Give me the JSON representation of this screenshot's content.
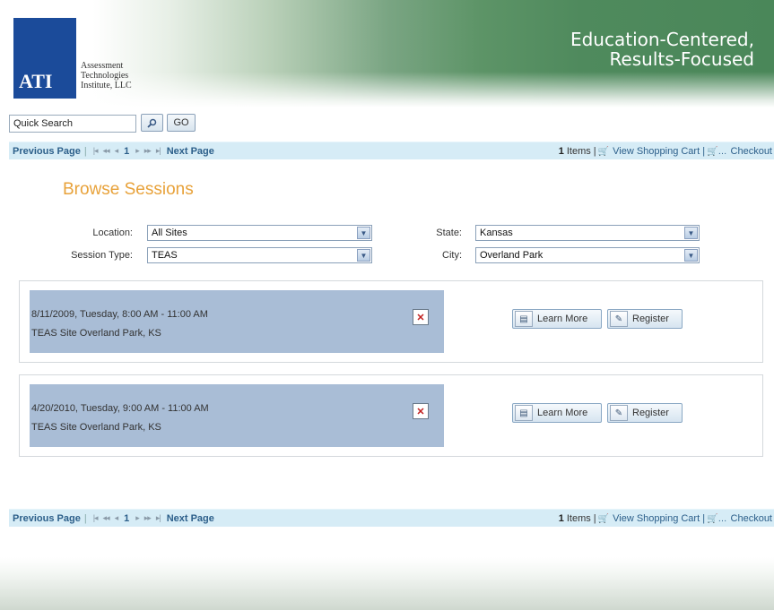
{
  "header": {
    "logo_letters": "ATI",
    "logo_line1": "Assessment",
    "logo_line2": "Technologies",
    "logo_line3": "Institute, LLC",
    "tagline_line1": "Education-Centered,",
    "tagline_line2": "Results-Focused"
  },
  "search": {
    "value": "Quick Search",
    "search_icon": "search-icon",
    "go_label": "GO"
  },
  "pager": {
    "previous_label": "Previous Page",
    "separator": "|",
    "first_glyph": "|◂",
    "prev_fast_glyph": "◂◂",
    "prev_glyph": "◂",
    "current_page": "1",
    "next_glyph": "▸",
    "next_fast_glyph": "▸▸",
    "last_glyph": "▸|",
    "next_label": "Next Page",
    "cart_count": "1",
    "items_label": "Items |",
    "view_cart_label": "View Shopping Cart |",
    "checkout_label": "Checkout"
  },
  "page_title": "Browse Sessions",
  "filters": {
    "location_label": "Location:",
    "location_value": "All Sites",
    "session_type_label": "Session Type:",
    "session_type_value": "TEAS",
    "state_label": "State:",
    "state_value": "Kansas",
    "city_label": "City:",
    "city_value": "Overland Park"
  },
  "sessions": [
    {
      "date": "8/11/2009, Tuesday, 8:00 AM - 11:00 AM",
      "site": "TEAS Site Overland Park, KS",
      "learn_more_label": "Learn More",
      "register_label": "Register"
    },
    {
      "date": "4/20/2010, Tuesday, 9:00 AM - 11:00 AM",
      "site": "TEAS Site Overland Park, KS",
      "learn_more_label": "Learn More",
      "register_label": "Register"
    }
  ],
  "colors": {
    "accent_title": "#e8a23a",
    "logo_blue": "#1b4b9a",
    "pager_bg": "#d6ecf6",
    "session_bg": "#a9bdd6",
    "link": "#2c5f8a"
  }
}
